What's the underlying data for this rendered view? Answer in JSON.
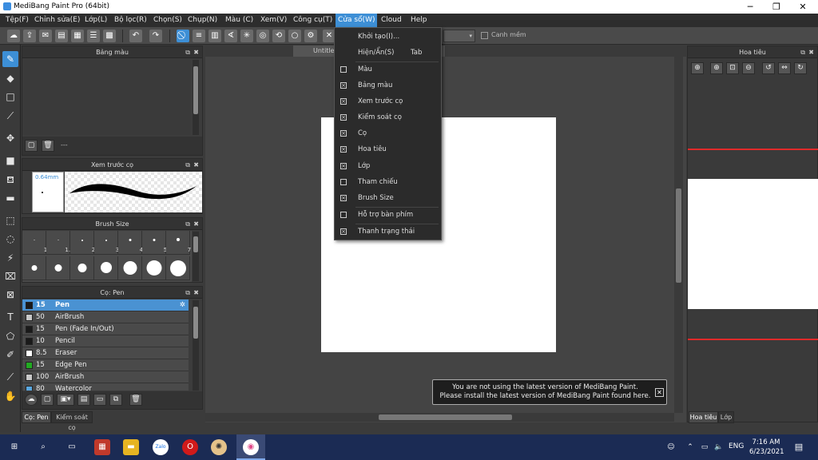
{
  "window": {
    "title": "MediBang Paint Pro (64bit)",
    "minimize_icon": "minimize-icon",
    "maximize_icon": "restore-icon",
    "close_icon": "close-icon"
  },
  "menubar": {
    "items": [
      "Tệp(F)",
      "Chỉnh sửa(E)",
      "Lớp(L)",
      "Bộ lọc(R)",
      "Chọn(S)",
      "Chụp(N)",
      "Màu (C)",
      "Xem(V)",
      "Công cụ(T)",
      "Cửa sổ(W)",
      "Cloud",
      "Help"
    ],
    "active_index": 9
  },
  "toolbar": {
    "snap_label": "Canh mềm",
    "accent_color": "#3d8fd6"
  },
  "window_menu": {
    "items": [
      {
        "label": "Khởi tạo(I)...",
        "shortcut": "",
        "checkbox": false,
        "checked": false
      },
      {
        "label": "Hiện/Ẩn(S)",
        "shortcut": "Tab",
        "checkbox": false,
        "checked": false
      },
      {
        "label": "Màu",
        "shortcut": "",
        "checkbox": true,
        "checked": false
      },
      {
        "label": "Bảng màu",
        "shortcut": "",
        "checkbox": true,
        "checked": true
      },
      {
        "label": "Xem trước cọ",
        "shortcut": "",
        "checkbox": true,
        "checked": true
      },
      {
        "label": "Kiểm soát cọ",
        "shortcut": "",
        "checkbox": true,
        "checked": true
      },
      {
        "label": "Cọ",
        "shortcut": "",
        "checkbox": true,
        "checked": true
      },
      {
        "label": "Hoa tiêu",
        "shortcut": "",
        "checkbox": true,
        "checked": true
      },
      {
        "label": "Lớp",
        "shortcut": "",
        "checkbox": true,
        "checked": true
      },
      {
        "label": "Tham chiếu",
        "shortcut": "",
        "checkbox": true,
        "checked": false
      },
      {
        "label": "Brush Size",
        "shortcut": "",
        "checkbox": true,
        "checked": true
      },
      {
        "label": "Hỗ trợ bàn phím",
        "shortcut": "",
        "checkbox": true,
        "checked": false
      },
      {
        "label": "Thanh trạng thái",
        "shortcut": "",
        "checkbox": true,
        "checked": true
      }
    ]
  },
  "panels": {
    "palette": {
      "title": "Bảng màu",
      "footer_text": "---"
    },
    "brush_preview": {
      "title": "Xem trước cọ",
      "size_label": "0.64mm"
    },
    "brush_size": {
      "title": "Brush Size",
      "small_labels": [
        "1",
        "1.5",
        "2",
        "3",
        "4",
        "5",
        "7"
      ]
    },
    "brush": {
      "title": "Cọ: Pen",
      "items": [
        {
          "size": "15",
          "name": "Pen",
          "color": "#1a1a1a",
          "selected": true
        },
        {
          "size": "50",
          "name": "AirBrush",
          "color": "#c8c8c8",
          "selected": false
        },
        {
          "size": "15",
          "name": "Pen (Fade In/Out)",
          "color": "#1a1a1a",
          "selected": false
        },
        {
          "size": "10",
          "name": "Pencil",
          "color": "#1a1a1a",
          "selected": false
        },
        {
          "size": "8.5",
          "name": "Eraser",
          "color": "#ffffff",
          "selected": false
        },
        {
          "size": "15",
          "name": "Edge Pen",
          "color": "#22aa22",
          "selected": false
        },
        {
          "size": "100",
          "name": "AirBrush",
          "color": "#c8c8c8",
          "selected": false
        },
        {
          "size": "80",
          "name": "Watercolor",
          "color": "#5aa8e0",
          "selected": false
        }
      ]
    },
    "bottom_tabs": [
      "Cọ: Pen",
      "Kiểm soát cọ"
    ],
    "navigator": {
      "title": "Hoa tiêu"
    },
    "right_tabs": [
      "Hoa tiêu",
      "Lớp"
    ]
  },
  "canvas": {
    "tab_title": "Untitled"
  },
  "notification": {
    "line1": "You are not using the latest version of MediBang Paint.",
    "line2": "Please install the latest version of MediBang Paint found here."
  },
  "taskbar": {
    "language": "ENG",
    "time": "7:16 AM",
    "date": "6/23/2021",
    "apps": [
      "windows-start-icon",
      "search-icon",
      "task-view-icon",
      "store-icon",
      "file-explorer-icon",
      "zalo-icon",
      "opera-icon",
      "paint-palette-icon",
      "medibang-icon"
    ]
  }
}
